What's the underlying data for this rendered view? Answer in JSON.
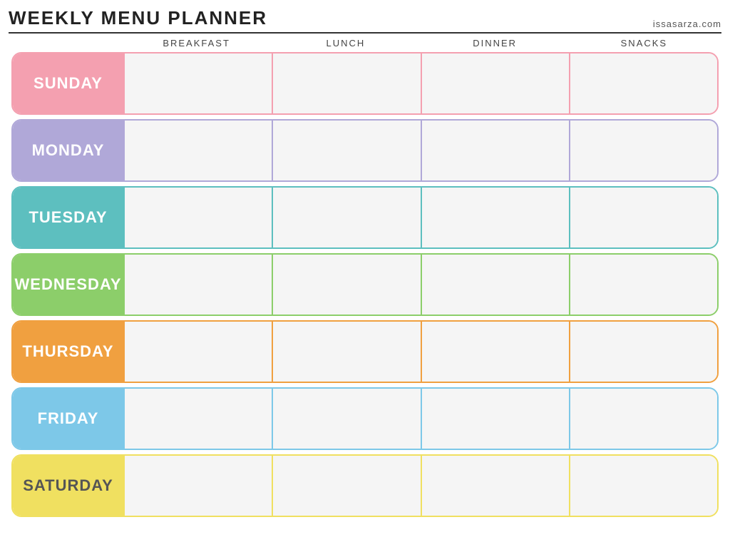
{
  "header": {
    "title": "Weekly Menu Planner",
    "website": "issasarza.com"
  },
  "columns": {
    "empty": "",
    "breakfast": "Breakfast",
    "lunch": "Lunch",
    "dinner": "Dinner",
    "snacks": "Snacks"
  },
  "days": [
    {
      "id": "sunday",
      "label": "Sunday",
      "class": "row-sunday",
      "color": "#f4a0b0"
    },
    {
      "id": "monday",
      "label": "Monday",
      "class": "row-monday",
      "color": "#b0a8d8"
    },
    {
      "id": "tuesday",
      "label": "Tuesday",
      "class": "row-tuesday",
      "color": "#5dbfbf"
    },
    {
      "id": "wednesday",
      "label": "Wednesday",
      "class": "row-wednesday",
      "color": "#8cce6a"
    },
    {
      "id": "thursday",
      "label": "Thursday",
      "class": "row-thursday",
      "color": "#f0a040"
    },
    {
      "id": "friday",
      "label": "Friday",
      "class": "row-friday",
      "color": "#7dc8e8"
    },
    {
      "id": "saturday",
      "label": "Saturday",
      "class": "row-saturday",
      "color": "#f0e060"
    }
  ]
}
